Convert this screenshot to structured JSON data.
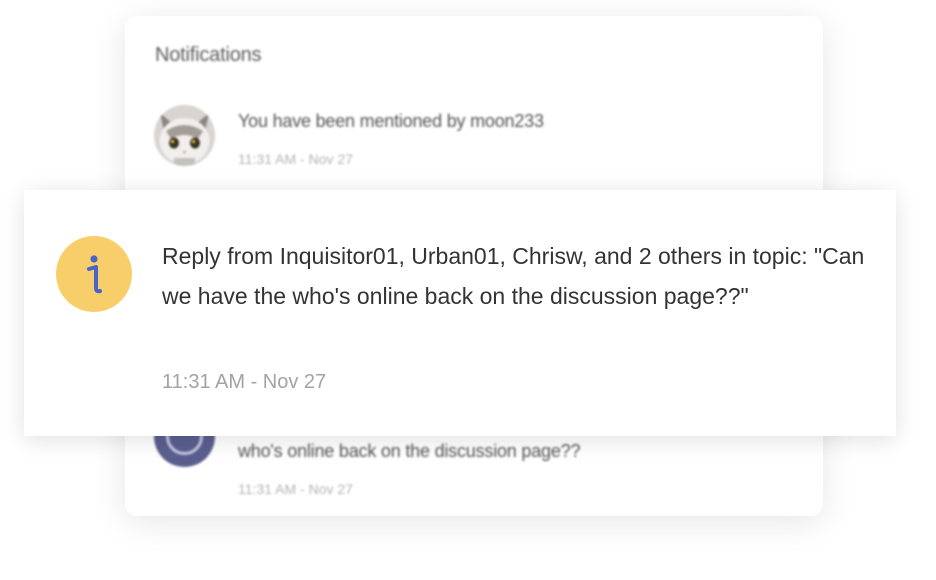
{
  "panel": {
    "title": "Notifications",
    "items": [
      {
        "text": "You have been mentioned by moon233",
        "time": "11:31 AM - Nov 27",
        "avatar_icon": "cat-avatar"
      },
      {
        "text": "who's online back on the discussion page??",
        "time": "11:31 AM - Nov 27",
        "avatar_icon": "user-avatar"
      }
    ]
  },
  "card": {
    "icon": "info-icon",
    "icon_bg_color": "#f8ce6a",
    "icon_color": "#4a63c7",
    "text": "Reply from Inquisitor01, Urban01, Chrisw, and 2 others in topic: \"Can we have the who's online back on the discussion page??\"",
    "time": "11:31 AM - Nov 27"
  }
}
